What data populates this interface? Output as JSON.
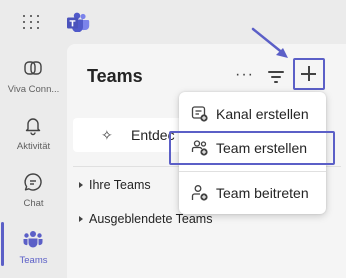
{
  "titlebar": {
    "app_icon": "teams-logo",
    "grid_icon": "app-launcher-icon"
  },
  "rail": {
    "items": [
      {
        "label": "Viva Conn...",
        "icon": "viva-connections-icon",
        "active": false
      },
      {
        "label": "Aktivität",
        "icon": "bell-icon",
        "active": false
      },
      {
        "label": "Chat",
        "icon": "chat-icon",
        "active": false
      },
      {
        "label": "Teams",
        "icon": "teams-icon",
        "active": true
      }
    ]
  },
  "panel": {
    "title": "Teams",
    "more_label": "···",
    "discover_label": "Entdec",
    "sections": [
      {
        "label": "Ihre Teams"
      },
      {
        "label": "Ausgeblendete Teams"
      }
    ]
  },
  "menu": {
    "items": [
      {
        "label": "Kanal erstellen",
        "icon": "channel-add-icon",
        "highlighted": false
      },
      {
        "label": "Team erstellen",
        "icon": "team-add-icon",
        "highlighted": true
      },
      {
        "label": "Team beitreten",
        "icon": "team-join-icon",
        "highlighted": false
      }
    ]
  },
  "colors": {
    "accent": "#5b5fc7",
    "background": "#ebebeb",
    "panel": "#f5f5f5",
    "menu": "#ffffff"
  }
}
